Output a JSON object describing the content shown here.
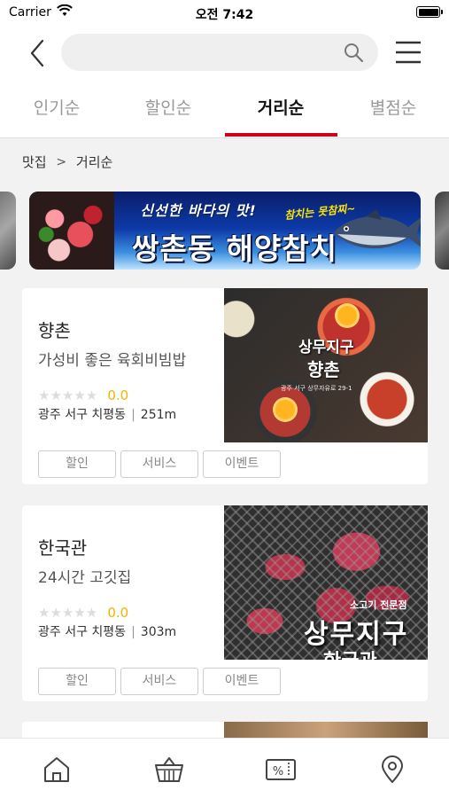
{
  "status": {
    "carrier": "Carrier",
    "time": "오전 7:42"
  },
  "search": {
    "placeholder": ""
  },
  "tabs": [
    {
      "label": "인기순",
      "active": false
    },
    {
      "label": "할인순",
      "active": false
    },
    {
      "label": "거리순",
      "active": true
    },
    {
      "label": "별점순",
      "active": false
    }
  ],
  "breadcrumb": {
    "category": "맛집",
    "current": "거리순"
  },
  "banner": {
    "tagline": "신선한 바다의 맛!",
    "title": "쌍촌동 해양참치",
    "slogan": "참치는 못참찌~"
  },
  "restaurants": [
    {
      "name": "향촌",
      "description": "가성비 좋은 육회비빔밥",
      "rating": "0.0",
      "stars": "★★★★★",
      "location": "광주 서구 치평동",
      "distance": "251m",
      "image_text": {
        "line1": "상무지구",
        "line2": "향촌",
        "line3": "광주 서구 상무자유로 29-1"
      },
      "buttons": [
        "할인",
        "서비스",
        "이벤트"
      ]
    },
    {
      "name": "한국관",
      "description": "24시간 고깃집",
      "rating": "0.0",
      "stars": "★★★★★",
      "location": "광주 서구 치평동",
      "distance": "303m",
      "image_text": {
        "line1": "소고기 전문점",
        "line2": "상무지구",
        "line3": "한국관"
      },
      "buttons": [
        "할인",
        "서비스",
        "이벤트"
      ]
    }
  ],
  "bottom_nav": [
    "home-icon",
    "basket-icon",
    "coupon-icon",
    "location-pin-icon"
  ],
  "colors": {
    "accent": "#d0021b",
    "rating": "#f0b400"
  }
}
